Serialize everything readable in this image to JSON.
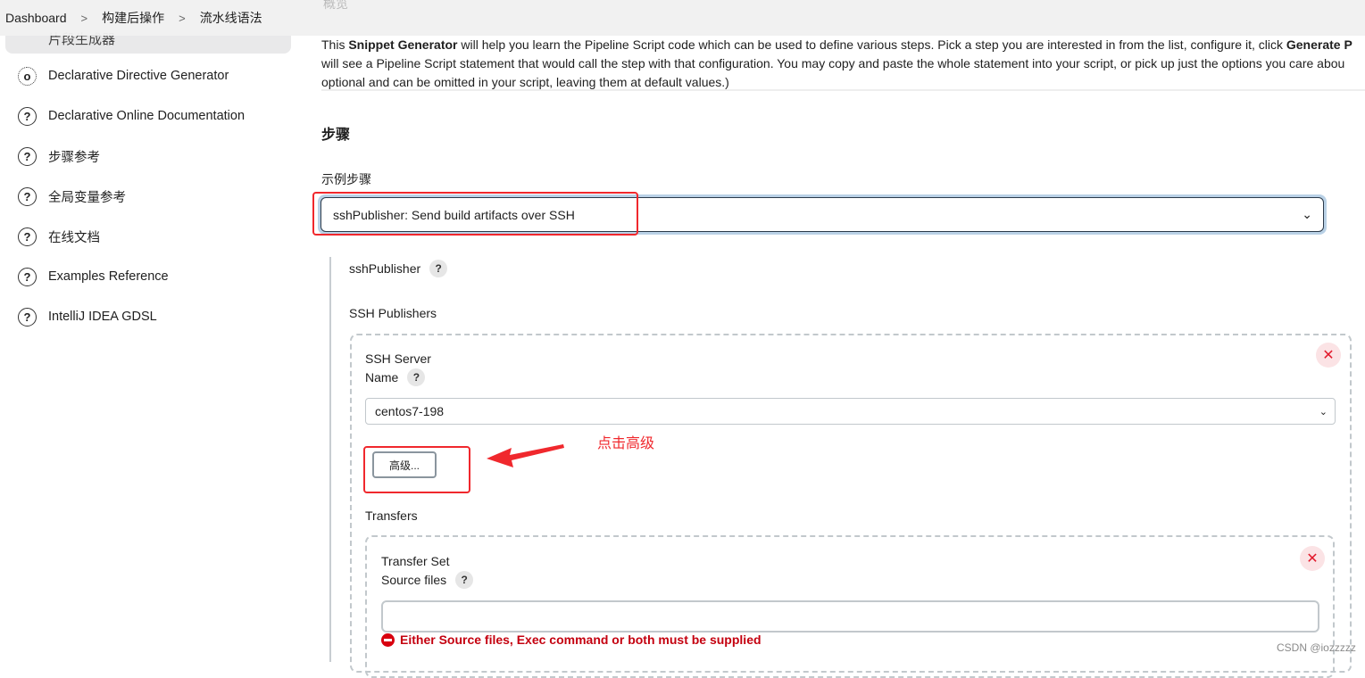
{
  "breadcrumb": {
    "items": [
      "Dashboard",
      "构建后操作",
      "流水线语法"
    ]
  },
  "sidebar": {
    "active": "片段生成器",
    "items": [
      {
        "icon": "gear-icon",
        "label": "Declarative Directive Generator"
      },
      {
        "icon": "help-circle-icon",
        "label": "Declarative Online Documentation"
      },
      {
        "icon": "help-circle-icon",
        "label": "步骤参考"
      },
      {
        "icon": "help-circle-icon",
        "label": "全局变量参考"
      },
      {
        "icon": "help-circle-icon",
        "label": "在线文档"
      },
      {
        "icon": "help-circle-icon",
        "label": "Examples Reference"
      },
      {
        "icon": "help-circle-icon",
        "label": "IntelliJ IDEA GDSL"
      }
    ]
  },
  "main": {
    "overview": "概览",
    "desc": {
      "p1": "This ",
      "b1": "Snippet Generator",
      "p2": " will help you learn the Pipeline Script code which can be used to define various steps. Pick a step you are interested in from the list, configure it, click ",
      "b2": "Generate P",
      "line2": "will see a Pipeline Script statement that would call the step with that configuration. You may copy and paste the whole statement into your script, or pick up just the options you care abou",
      "line3": "optional and can be omitted in your script, leaving them at default values.)"
    },
    "steps_heading": "步骤",
    "sample_step_label": "示例步骤",
    "sample_step_value": "sshPublisher: Send build artifacts over SSH",
    "ssh_publisher_label": "sshPublisher",
    "ssh_publishers_label": "SSH Publishers",
    "ssh_server_label": "SSH Server",
    "name_label": "Name",
    "name_value": "centos7-198",
    "advanced_button": "高级...",
    "transfers_label": "Transfers",
    "transfer_set_label": "Transfer Set",
    "source_files_label": "Source files",
    "source_files_value": "",
    "error": "Either Source files, Exec command or both must be supplied"
  },
  "annotation": "点击高级",
  "watermark": "CSDN @iozzzzz",
  "colors": {
    "annotation": "#f0282d",
    "error": "#c4000f",
    "focus_ring": "#b9d1e6"
  }
}
